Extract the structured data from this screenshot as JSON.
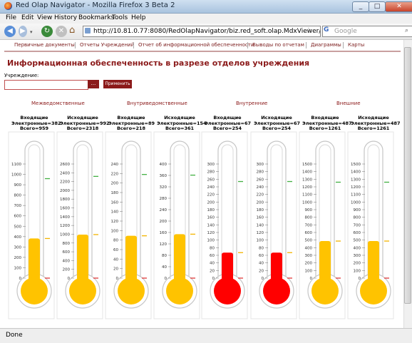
{
  "window": {
    "title": "Red Olap Navigator - Mozilla Firefox 3 Beta 2",
    "buttons": {
      "minimize": "_",
      "maximize": "□",
      "close": "✕"
    }
  },
  "menu": [
    "File",
    "Edit",
    "View",
    "History",
    "Bookmarks",
    "Tools",
    "Help"
  ],
  "address": {
    "url": "http://10.81.0.77:8080/RedOlapNavigator/biz.red_soft.olap.MdxViewer/MdxV",
    "search_placeholder": "Google"
  },
  "nav_tabs": [
    "Первичные документы",
    "Отчеты Учреждений",
    "Отчет об информационной обеспеченности",
    "Выводы по отчетам",
    "Диаграммы",
    "Карты"
  ],
  "page_title": "Информационная обеспеченность в разрезе отделов учреждения",
  "institution": {
    "label": "Учреждение:",
    "value": "",
    "dots_label": "...",
    "apply_label": "Применить"
  },
  "groups": [
    "Межведомственные",
    "Внутриведомственные",
    "Внутренние",
    "Внешние"
  ],
  "gauges": [
    {
      "header": [
        "Входящие",
        "Электронные=382",
        "Всего=959"
      ],
      "value": 382,
      "max": 1100,
      "step": 100,
      "green": 959,
      "color": "#ffc300"
    },
    {
      "header": [
        "Исходящие",
        "Электронные=992",
        "Всего=2318"
      ],
      "value": 992,
      "max": 2600,
      "step": 200,
      "green": 2318,
      "color": "#ffc300"
    },
    {
      "header": [
        "Входящие",
        "Электронные=89",
        "Всего=218"
      ],
      "value": 89,
      "max": 240,
      "step": 20,
      "green": 218,
      "color": "#ffc300"
    },
    {
      "header": [
        "Исходящие",
        "Электронные=154",
        "Всего=361"
      ],
      "value": 154,
      "max": 400,
      "step": 40,
      "green": 361,
      "color": "#ffc300"
    },
    {
      "header": [
        "Входящие",
        "Электронные=67",
        "Всего=254"
      ],
      "value": 67,
      "max": 300,
      "step": 20,
      "green": 254,
      "color": "#ff0000"
    },
    {
      "header": [
        "Исходящие",
        "Электронные=67",
        "Всего=254"
      ],
      "value": 67,
      "max": 300,
      "step": 20,
      "green": 254,
      "color": "#ff0000"
    },
    {
      "header": [
        "Входящие",
        "Электронные=487",
        "Всего=1261"
      ],
      "value": 487,
      "max": 1500,
      "step": 100,
      "green": 1261,
      "color": "#ffc300"
    },
    {
      "header": [
        "Исходящие",
        "Электронные=487",
        "Всего=1261"
      ],
      "value": 487,
      "max": 1500,
      "step": 100,
      "green": 1261,
      "color": "#ffc300"
    }
  ],
  "status": "Done"
}
